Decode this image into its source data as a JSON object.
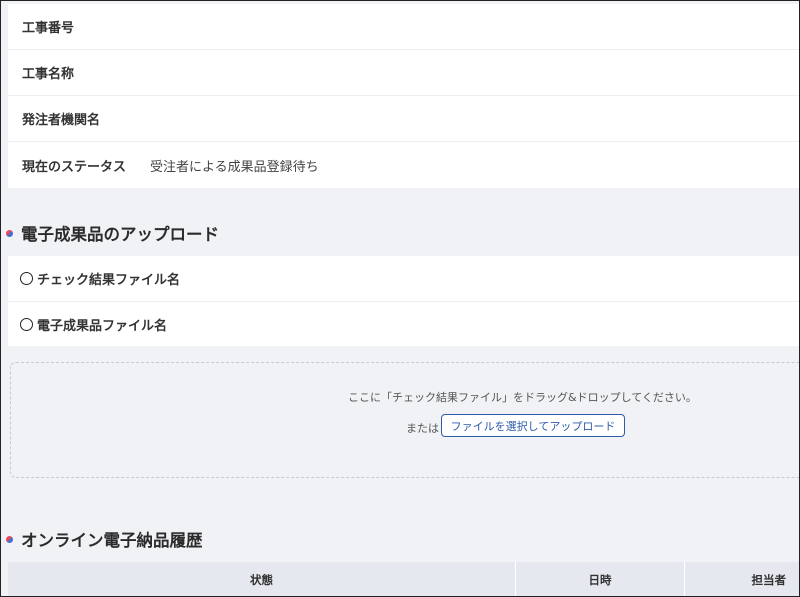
{
  "project_info": {
    "rows": [
      {
        "label": "工事番号",
        "value": ""
      },
      {
        "label": "工事名称",
        "value": ""
      },
      {
        "label": "発注者機関名",
        "value": ""
      },
      {
        "label": "現在のステータス",
        "value": "受注者による成果品登録待ち"
      }
    ]
  },
  "upload_section": {
    "title": "電子成果品のアップロード",
    "files": [
      {
        "label": "チェック結果ファイル名"
      },
      {
        "label": "電子成果品ファイル名"
      }
    ],
    "dropzone": {
      "message": "ここに「チェック結果ファイル」をドラッグ&ドロップしてください。",
      "or_text": "または",
      "select_button_label": "ファイルを選択してアップロード"
    }
  },
  "history_section": {
    "title": "オンライン電子納品履歴",
    "columns": [
      "状態",
      "日時",
      "担当者"
    ]
  }
}
